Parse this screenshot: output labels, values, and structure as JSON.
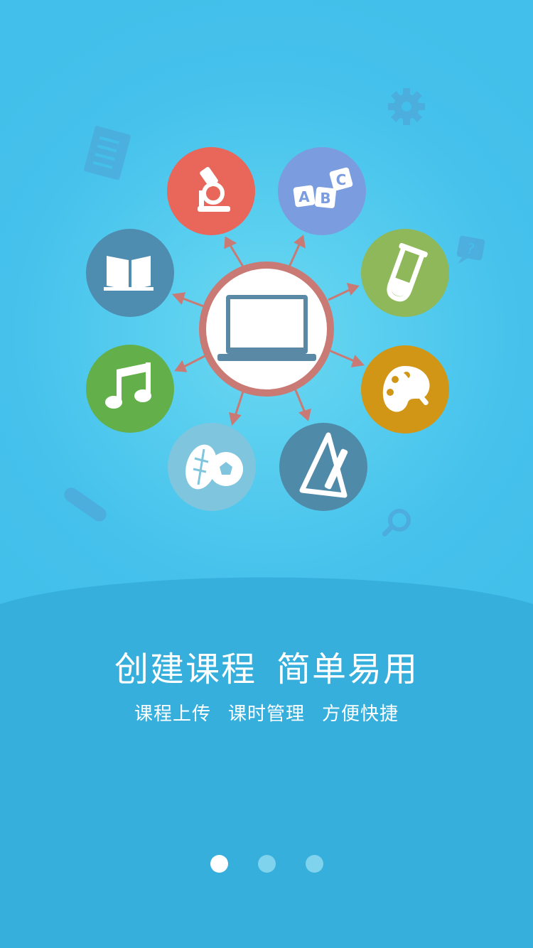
{
  "headline": [
    "创建课程",
    "简单易用"
  ],
  "subline": [
    "课程上传",
    "课时管理",
    "方便快捷"
  ],
  "pager": {
    "count": 3,
    "active_index": 0
  },
  "colors": {
    "background": "#42bfea",
    "wave": "#36afdc",
    "hub_ring": "#c97a74",
    "arrow": "#c97a74",
    "science": "#e8665a",
    "abc": "#7b9de0",
    "chemistry": "#8fb85a",
    "art": "#d19616",
    "geometry": "#4f8aa8",
    "sports": "#7fc5de",
    "music": "#63b04a",
    "reading": "#4f8db0",
    "decor_icons": "#4ea8d8"
  },
  "icons": [
    "microscope-icon",
    "abc-blocks-icon",
    "test-tube-icon",
    "palette-icon",
    "ruler-pencil-icon",
    "sports-balls-icon",
    "music-note-icon",
    "open-book-icon",
    "laptop-icon"
  ]
}
